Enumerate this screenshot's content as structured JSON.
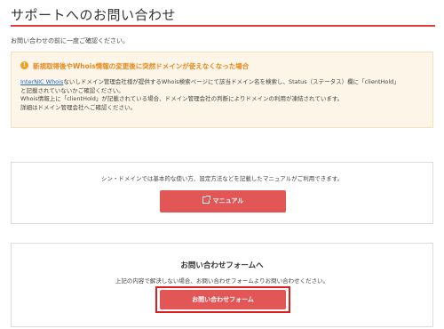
{
  "page": {
    "title": "サポートへのお問い合わせ",
    "intro": "お問い合わせの前に一度ご確認ください。"
  },
  "notice": {
    "icon": "exclamation-icon",
    "title": "新規取得後やWhois情報の変更後に突然ドメインが使えなくなった場合",
    "link_text": "InterNIC Whois",
    "line1_rest": "ないしドメイン管理会社様が提供するWhois検索ページにて該当ドメイン名を検索し、Status（ステータス）欄に「clientHold」",
    "line2": "と記載されていないかご確認ください。",
    "line3": "Whois情報上に「clientHold」が記載されている場合、ドメイン管理会社の判断によりドメインの利用が凍結されています。",
    "line4": "詳細はドメイン管理会社へご確認ください。",
    "colors": {
      "background": "#fdf6e8",
      "title": "#e8871e",
      "icon": "#f0a020"
    }
  },
  "manual_card": {
    "text": "シン・ドメインでは基本的な使い方、設定方法などを記載したマニュアルがご利用できます。",
    "button_label": "マニュアル",
    "button_icon": "external-link-icon"
  },
  "inquiry_card": {
    "heading": "お問い合わせフォームへ",
    "text": "上記の内容で解決しない場合、お問い合わせフォームよりお問い合わせください。",
    "button_label": "お問い合わせフォーム"
  },
  "colors": {
    "accent": "#e23b3b",
    "button": "#e35656",
    "highlight": "#e01e1e"
  }
}
